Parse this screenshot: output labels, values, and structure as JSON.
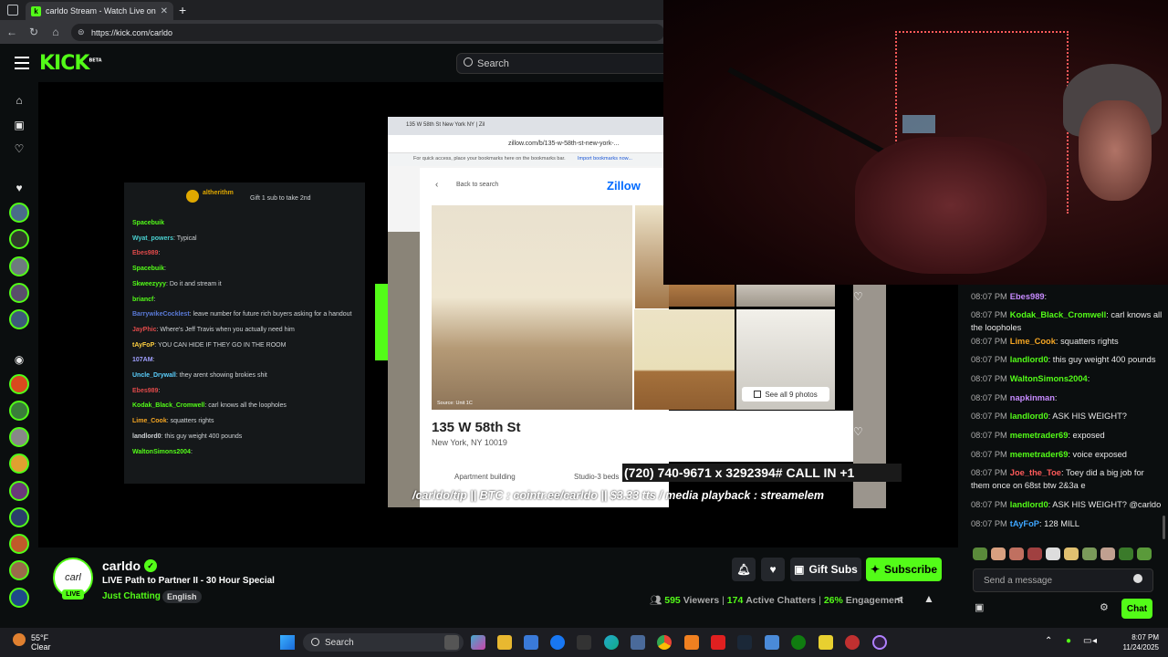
{
  "browser": {
    "tab_title": "carldo Stream - Watch Live on Ki",
    "url": "https://kick.com/carldo"
  },
  "kick": {
    "logo": "KICK",
    "logo_badge": "BETA",
    "search_placeholder": "Search"
  },
  "stream_overlay": {
    "chat_lines": [
      {
        "user": "altherithm",
        "text": "Gift 1 sub to take 2nd"
      },
      {
        "user": "Spacebuik",
        "text": ""
      },
      {
        "user": "Wyat_powers",
        "text": ": Typical"
      },
      {
        "user": "Ebes989",
        "text": ":"
      },
      {
        "user": "Spacebuik",
        "text": ":"
      },
      {
        "user": "Skweezyyy",
        "text": ": Do it and stream it"
      },
      {
        "user": "briancf",
        "text": ":"
      },
      {
        "user": "BarrywikeCocklest",
        "text": ": leave number for future rich buyers asking for a handout"
      },
      {
        "user": "JayPhic",
        "text": ": Where's Jeff Travis when you actually need him"
      },
      {
        "user": "tAyFoP",
        "text": ": YOU CAN HIDE IF THEY GO IN THE ROOM"
      },
      {
        "user": "107AM",
        "text": ":"
      },
      {
        "user": "Uncle_Drywall",
        "text": ": they arent showing brokies shit"
      },
      {
        "user": "Ebes989",
        "text": ":"
      },
      {
        "user": "Kodak_Black_Cromwell",
        "text": ": carl knows all the loopholes"
      },
      {
        "user": "Lime_Cook",
        "text": ": squatters rights"
      },
      {
        "user": "landlord0",
        "text": ": this guy weight 400 pounds"
      },
      {
        "user": "WaltonSimons2004",
        "text": ":"
      }
    ],
    "zillow": {
      "tab_title": "135 W 58th St New York NY | Zil",
      "url": "zillow.com/b/135-w-58th-st-new-york-...",
      "bookmarks_hint": "For quick access, place your bookmarks here on the bookmarks bar.",
      "bookmarks_link": "Import bookmarks now...",
      "back_link": "Back to search",
      "brand": "Zillow",
      "photo_source": "Source: Unit 1C",
      "see_all": "See all 9 photos",
      "address": "135 W 58th St",
      "city": "New York, NY 10019",
      "tag_1": "Apartment building",
      "tag_2": "Studio-3 beds"
    },
    "phone_banner": "(720) 740-9671 x 3292394#   CALL IN +1",
    "tip_banner": "/carldo/tip || BTC : cointr.ee/carldo || $3.33 tts / media playback : streamelem"
  },
  "streamer": {
    "avatar_text": "carl",
    "live_badge": "LIVE",
    "name": "carldo",
    "title": "LIVE Path to Partner II - 30 Hour Special",
    "category": "Just Chatting",
    "language": "English"
  },
  "actions": {
    "gift_subs": "Gift Subs",
    "subscribe": "Subscribe"
  },
  "stats": {
    "viewers": "595",
    "viewers_label": "Viewers",
    "chatters": "174",
    "chatters_label": "Active Chatters",
    "engagement": "26%",
    "engagement_label": "Engagement"
  },
  "chat": {
    "messages": [
      {
        "time": "08:07 PM",
        "user": "Ebes989",
        "color": "#c78bff",
        "text": ":"
      },
      {
        "time": "08:07 PM",
        "user": "Kodak_Black_Cromwell",
        "color": "#53fc18",
        "text": ": carl knows all the loopholes"
      },
      {
        "time": "08:07 PM",
        "user": "Lime_Cook",
        "color": "#f5a623",
        "text": ": squatters rights"
      },
      {
        "time": "08:07 PM",
        "user": "landlord0",
        "color": "#53fc18",
        "text": ": this guy weight 400 pounds"
      },
      {
        "time": "08:07 PM",
        "user": "WaltonSimons2004",
        "color": "#53fc18",
        "text": ":"
      },
      {
        "time": "08:07 PM",
        "user": "napkinman",
        "color": "#c78bff",
        "text": ":"
      },
      {
        "time": "08:07 PM",
        "user": "landlord0",
        "color": "#53fc18",
        "text": ": ASK HIS WEIGHT?"
      },
      {
        "time": "08:07 PM",
        "user": "memetrader69",
        "color": "#53fc18",
        "text": ": exposed"
      },
      {
        "time": "08:07 PM",
        "user": "memetrader69",
        "color": "#53fc18",
        "text": ": voice exposed"
      },
      {
        "time": "08:07 PM",
        "user": "Joe_the_Toe",
        "color": "#ff5a5a",
        "text": ": Toey did a big job for them once on 68st btw 2&3a e"
      },
      {
        "time": "08:07 PM",
        "user": "landlord0",
        "color": "#53fc18",
        "text": ": ASK HIS WEIGHT? @carldo"
      },
      {
        "time": "08:07 PM",
        "user": "tAyFoP",
        "color": "#3ea6ff",
        "text": ": 128 MILL"
      }
    ],
    "input_placeholder": "Send a message",
    "send_label": "Chat"
  },
  "taskbar": {
    "temp": "55°F",
    "condition": "Clear",
    "search": "Search",
    "time": "8:07 PM",
    "date": "11/24/2025"
  },
  "colors": {
    "accent": "#53fc18",
    "background": "#0b0e0f"
  }
}
